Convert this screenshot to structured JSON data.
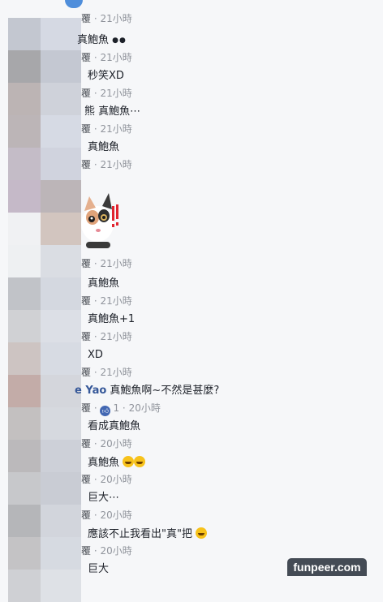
{
  "comments": [
    {
      "name": "",
      "text": "",
      "time": "21小時",
      "reply": "覆"
    },
    {
      "name": "",
      "text": "真鮑魚",
      "time": "21小時",
      "reply": "覆"
    },
    {
      "name": "",
      "text": "秒笑XD",
      "time": "21小時",
      "reply": "覆"
    },
    {
      "name": "",
      "text": "熊 真鮑魚⋯",
      "time": "21小時",
      "reply": "覆"
    },
    {
      "name": "",
      "text": "真鮑魚",
      "time": "21小時",
      "reply": "覆"
    },
    {
      "name": "",
      "text": "",
      "time": "21小時",
      "reply": "覆"
    },
    {
      "name": "",
      "text": "真鮑魚",
      "time": "21小時",
      "reply": "覆"
    },
    {
      "name": "",
      "text": "真鮑魚+1",
      "time": "21小時",
      "reply": "覆"
    },
    {
      "name": "",
      "text": "XD",
      "time": "21小時",
      "reply": "覆"
    },
    {
      "name": "e Yao",
      "text": "真鮑魚啊~不然是甚麼?",
      "time": "20小時",
      "reply": "覆",
      "likes": "1"
    },
    {
      "name": "",
      "text": "看成真鮑魚",
      "time": "20小時",
      "reply": "覆"
    },
    {
      "name": "",
      "text": "真鮑魚",
      "time": "20小時",
      "reply": "覆"
    },
    {
      "name": "",
      "text": "巨大⋯",
      "time": "20小時",
      "reply": "覆"
    },
    {
      "name": "",
      "text": "應該不止我看出\"真\"把",
      "time": "20小時",
      "reply": "覆"
    },
    {
      "name": "",
      "text": "巨大",
      "time": "",
      "reply": ""
    }
  ],
  "watermark": "funpeer.com",
  "colors": {
    "background": "#f6f7f9",
    "link_blue": "#365899",
    "meta_gray": "#90949c",
    "like_blue": "#4267b2"
  },
  "icons": {
    "top_avatar": "bird-icon",
    "sticker": "cat-sticker",
    "like": "like-badge-icon",
    "emoji": "laughing-emoji-icon"
  }
}
